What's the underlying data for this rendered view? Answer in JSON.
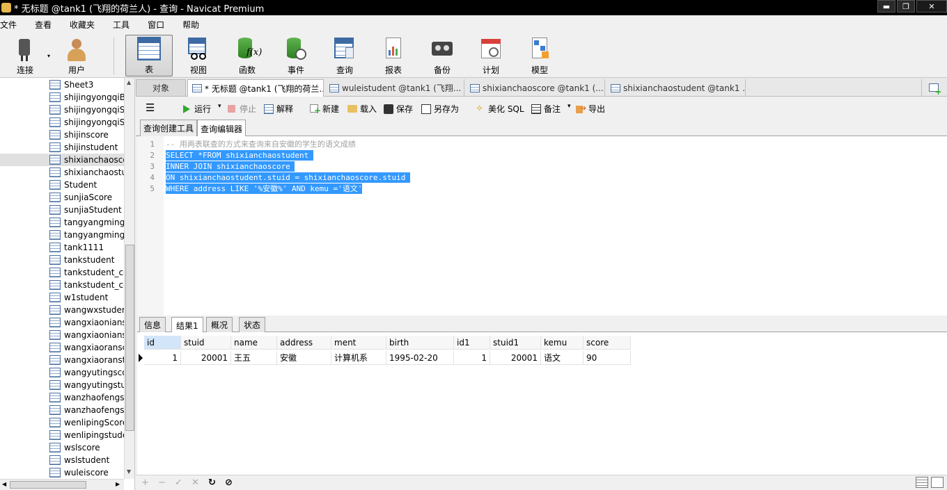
{
  "window": {
    "title": "* 无标题 @tank1 (飞翔的荷兰人) - 查询 - Navicat Premium",
    "minimize": "▬",
    "restore": "❐",
    "close": "✕"
  },
  "menu": [
    "文件",
    "查看",
    "收藏夹",
    "工具",
    "窗口",
    "帮助"
  ],
  "toolbar": {
    "connect": "连接",
    "user": "用户",
    "items": [
      "表",
      "视图",
      "函数",
      "事件",
      "查询",
      "报表",
      "备份",
      "计划",
      "模型"
    ],
    "active": "表"
  },
  "tree": {
    "items": [
      "Sheet3",
      "shijingyongqiB",
      "shijingyongqiS",
      "shijingyongqiS",
      "shijinscore",
      "shijinstudent",
      "shixianchaosco",
      "shixianchaostu",
      "Student",
      "sunjiaScore",
      "sunjiaStudent",
      "tangyangmings",
      "tangyangmings",
      "tank1111",
      "tankstudent",
      "tankstudent_cc",
      "tankstudent_cc",
      "w1student",
      "wangwxstuden",
      "wangxiaonians",
      "wangxiaonians",
      "wangxiaoransc",
      "wangxiaoranst",
      "wangyutingsco",
      "wangyutingstu",
      "wanzhaofengs",
      "wanzhaofengs",
      "wenlipingScore",
      "wenlipingstude",
      "wslscore",
      "wslstudent",
      "wuleiscore"
    ],
    "selected_index": 6
  },
  "doc_tabs": {
    "objects": "对象",
    "tabs": [
      "* 无标题 @tank1 (飞翔的荷兰...",
      "wuleistudent @tank1 (飞翔...",
      "shixianchaoscore @tank1 (...",
      "shixianchaostudent @tank1 ..."
    ]
  },
  "query_toolbar": {
    "menu_icon": "☰",
    "run": "运行",
    "stop": "停止",
    "explain": "解释",
    "new": "新建",
    "load": "载入",
    "save": "保存",
    "save_as": "另存为",
    "beautify": "美化 SQL",
    "notes": "备注",
    "export": "导出"
  },
  "editor_tabs": [
    "查询创建工具",
    "查询编辑器"
  ],
  "editor": {
    "line_numbers": [
      "1",
      "2",
      "3",
      "4",
      "5"
    ],
    "lines": [
      "-- 用两表联查的方式来查询来自安徽的学生的语文成绩",
      "SELECT *FROM shixianchaostudent ",
      "INNER JOIN shixianchaoscore ",
      "ON shixianchaostudent.stuid = shixianchaoscore.stuid ",
      "WHERE address LIKE '%安徽%' AND kemu ='语文'"
    ]
  },
  "result_tabs": [
    "信息",
    "结果1",
    "概况",
    "状态"
  ],
  "result": {
    "columns": [
      "id",
      "stuid",
      "name",
      "address",
      "ment",
      "birth",
      "id1",
      "stuid1",
      "kemu",
      "score"
    ],
    "rows": [
      [
        "1",
        "20001",
        "王五",
        "安徽",
        "计算机系",
        "1995-02-20",
        "1",
        "20001",
        "语文",
        "90"
      ]
    ]
  },
  "statusbar": {
    "add": "+",
    "remove": "−",
    "apply": "✓",
    "discard": "✕",
    "refresh": "↻",
    "stop": "⊘"
  },
  "colors": {
    "selection": "#3399ff",
    "run_green": "#2fa82f",
    "stop_red": "#d9534f"
  }
}
